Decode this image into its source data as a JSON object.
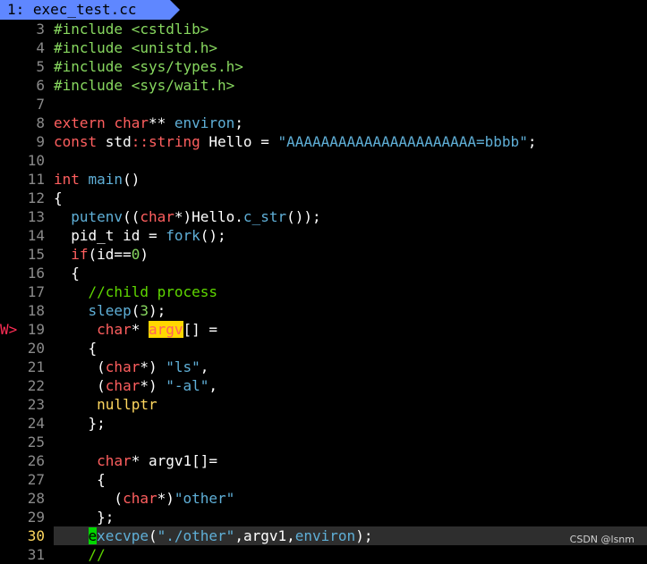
{
  "tab": {
    "label": "1: exec_test.cc"
  },
  "sign_marker": "W>",
  "current_line": "30",
  "lines": [
    {
      "n": "3",
      "segs": [
        [
          "pp",
          "#include <cstdlib>"
        ]
      ]
    },
    {
      "n": "4",
      "segs": [
        [
          "pp",
          "#include <unistd.h>"
        ]
      ]
    },
    {
      "n": "5",
      "segs": [
        [
          "pp",
          "#include <sys/types.h>"
        ]
      ]
    },
    {
      "n": "6",
      "segs": [
        [
          "pp",
          "#include <sys/wait.h>"
        ]
      ]
    },
    {
      "n": "7",
      "segs": []
    },
    {
      "n": "8",
      "segs": [
        [
          "kw",
          "extern "
        ],
        [
          "ty",
          "char"
        ],
        [
          "",
          "** "
        ],
        [
          "fn",
          "environ"
        ],
        [
          "",
          ";"
        ]
      ]
    },
    {
      "n": "9",
      "segs": [
        [
          "kw",
          "const "
        ],
        [
          "",
          "std"
        ],
        [
          "kw",
          "::"
        ],
        [
          "ty",
          "string"
        ],
        [
          "",
          " Hello = "
        ],
        [
          "str",
          "\"AAAAAAAAAAAAAAAAAAAAAA=bbbb\""
        ],
        [
          "",
          ";"
        ]
      ]
    },
    {
      "n": "10",
      "segs": []
    },
    {
      "n": "11",
      "segs": [
        [
          "ty",
          "int "
        ],
        [
          "fn",
          "main"
        ],
        [
          "",
          "()"
        ]
      ]
    },
    {
      "n": "12",
      "segs": [
        [
          "",
          "{"
        ]
      ]
    },
    {
      "n": "13",
      "segs": [
        [
          "",
          "  "
        ],
        [
          "fn",
          "putenv"
        ],
        [
          "",
          "(("
        ],
        [
          "ty",
          "char"
        ],
        [
          "",
          "*)Hello."
        ],
        [
          "fn",
          "c_str"
        ],
        [
          "",
          "());"
        ]
      ]
    },
    {
      "n": "14",
      "segs": [
        [
          "",
          "  pid_t id = "
        ],
        [
          "fn",
          "fork"
        ],
        [
          "",
          "();"
        ]
      ]
    },
    {
      "n": "15",
      "segs": [
        [
          "",
          "  "
        ],
        [
          "kw",
          "if"
        ],
        [
          "",
          "(id=="
        ],
        [
          "num",
          "0"
        ],
        [
          "",
          ")"
        ]
      ]
    },
    {
      "n": "16",
      "segs": [
        [
          "",
          "  {"
        ]
      ]
    },
    {
      "n": "17",
      "segs": [
        [
          "",
          "    "
        ],
        [
          "cm",
          "//child process"
        ]
      ]
    },
    {
      "n": "18",
      "segs": [
        [
          "",
          "    "
        ],
        [
          "fn",
          "sleep"
        ],
        [
          "",
          "("
        ],
        [
          "num",
          "3"
        ],
        [
          "",
          "); "
        ]
      ]
    },
    {
      "n": "19",
      "sign": true,
      "segs": [
        [
          "",
          "     "
        ],
        [
          "ty",
          "char"
        ],
        [
          "",
          "* "
        ],
        [
          "hl",
          "argv"
        ],
        [
          "",
          "[] ="
        ]
      ]
    },
    {
      "n": "20",
      "segs": [
        [
          "",
          "    {"
        ]
      ]
    },
    {
      "n": "21",
      "segs": [
        [
          "",
          "     ("
        ],
        [
          "ty",
          "char"
        ],
        [
          "",
          "*) "
        ],
        [
          "str",
          "\"ls\""
        ],
        [
          "",
          ","
        ]
      ]
    },
    {
      "n": "22",
      "segs": [
        [
          "",
          "     ("
        ],
        [
          "ty",
          "char"
        ],
        [
          "",
          "*) "
        ],
        [
          "str",
          "\"-al\""
        ],
        [
          "",
          ","
        ]
      ]
    },
    {
      "n": "23",
      "segs": [
        [
          "",
          "     "
        ],
        [
          "nl",
          "nullptr"
        ]
      ]
    },
    {
      "n": "24",
      "segs": [
        [
          "",
          "    };"
        ]
      ]
    },
    {
      "n": "25",
      "segs": []
    },
    {
      "n": "26",
      "segs": [
        [
          "",
          "     "
        ],
        [
          "ty",
          "char"
        ],
        [
          "",
          "* argv1[]="
        ]
      ]
    },
    {
      "n": "27",
      "segs": [
        [
          "",
          "     {"
        ]
      ]
    },
    {
      "n": "28",
      "segs": [
        [
          "",
          "       ("
        ],
        [
          "ty",
          "char"
        ],
        [
          "",
          "*)"
        ],
        [
          "str",
          "\"other\""
        ]
      ]
    },
    {
      "n": "29",
      "segs": [
        [
          "",
          "     };"
        ]
      ]
    },
    {
      "n": "30",
      "current": true,
      "segs": [
        [
          "",
          "    "
        ],
        [
          "cur-cell",
          "e"
        ],
        [
          "fn",
          "xecvpe"
        ],
        [
          "",
          "("
        ],
        [
          "str",
          "\"./other\""
        ],
        [
          "",
          ",argv1,"
        ],
        [
          "fn",
          "environ"
        ],
        [
          "",
          "); "
        ]
      ]
    },
    {
      "n": "31",
      "segs": [
        [
          "cm",
          "    //"
        ]
      ]
    }
  ],
  "watermark": "CSDN @lsnm",
  "colors": {
    "background": "#000000",
    "tab": "#5f87ff",
    "preprocessor": "#87d75f",
    "keyword": "#ff5f5f",
    "function": "#5fafd7",
    "comment": "#5fd700",
    "highlight": "#ffd700",
    "cursor": "#00d700"
  }
}
